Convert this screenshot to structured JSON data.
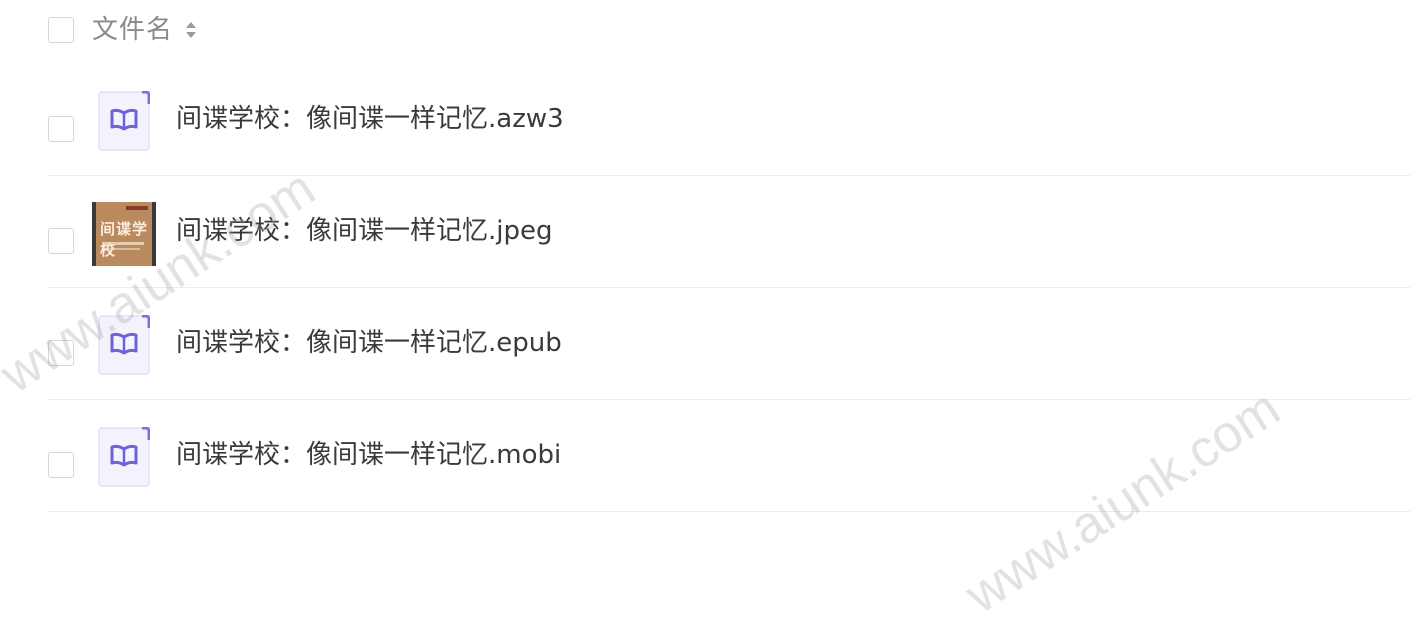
{
  "header": {
    "filename_label": "文件名",
    "sort_icon": "sort-icon"
  },
  "files": [
    {
      "name": "间谍学校：像间谍一样记忆.azw3",
      "icon": "ebook-icon"
    },
    {
      "name": "间谍学校：像间谍一样记忆.jpeg",
      "icon": "image-thumbnail",
      "thumbnail_text": "间谍学校"
    },
    {
      "name": "间谍学校：像间谍一样记忆.epub",
      "icon": "ebook-icon"
    },
    {
      "name": "间谍学校：像间谍一样记忆.mobi",
      "icon": "ebook-icon"
    }
  ],
  "watermark": "www.aiunk.com",
  "colors": {
    "icon_accent": "#7b72e0",
    "icon_bg": "#f4f3fd",
    "divider": "#ececec"
  }
}
